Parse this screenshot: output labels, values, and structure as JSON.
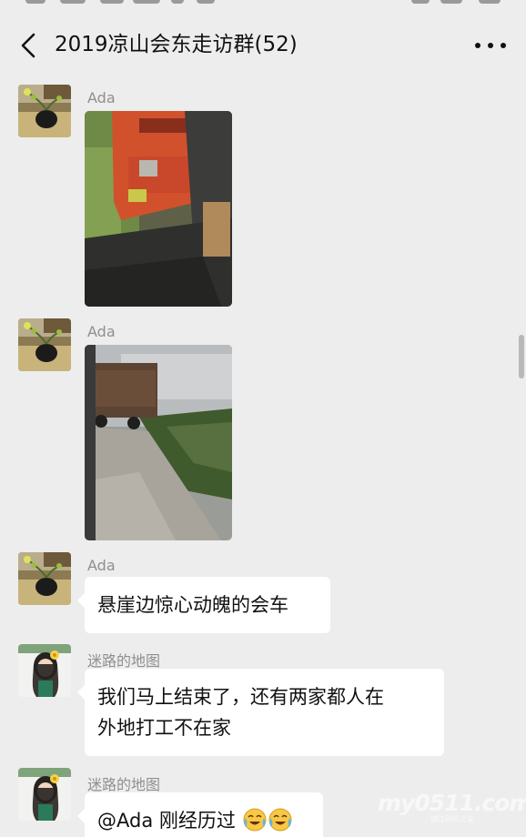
{
  "header": {
    "title": "2019凉山会东走访群(52)"
  },
  "icons": {
    "back": "back-chevron-icon",
    "more": "more-dots-icon"
  },
  "messages": [
    {
      "sender": "Ada",
      "type": "image",
      "image": "red-truck-through-windshield-photo"
    },
    {
      "sender": "Ada",
      "type": "image",
      "image": "truck-on-cliff-road-photo"
    },
    {
      "sender": "Ada",
      "type": "text",
      "text": "悬崖边惊心动魄的会车"
    },
    {
      "sender": "迷路的地图",
      "type": "text",
      "text_line1": "我们马上结束了，还有两家都人在",
      "text_line2": "外地打工不在家"
    },
    {
      "sender": "迷路的地图",
      "type": "text",
      "text": "@Ada  刚经历过",
      "emoji": "crying-laughing-face-icon"
    }
  ],
  "watermark": {
    "text": "my0511.com",
    "sub": "镇江网民之家"
  }
}
